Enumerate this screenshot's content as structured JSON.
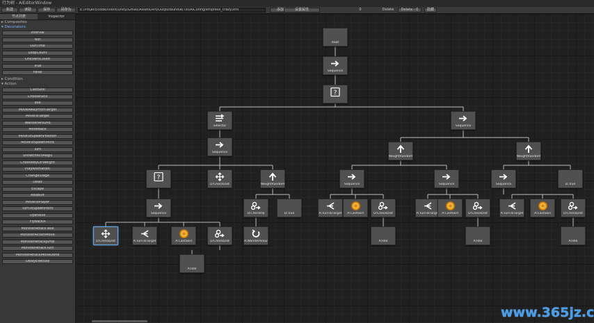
{
  "window": {
    "title": "行为树 - AiEditorWindow",
    "toolbar": {
      "buttons": [
        "新建",
        "读取",
        "保存",
        "另存为"
      ],
      "path": "E:/Project/code/client/unity/Gmall/Assets/Art/OutputBundle/Txt/AiConfig/empress_crazy.xml",
      "action_buttons": [
        "添加节点",
        "设置属性"
      ],
      "zoom": "0",
      "mode": "Delete",
      "mode2": "Delete - 0",
      "extra": "隐藏"
    }
  },
  "sidebar": {
    "tabs": [
      "节点列表",
      "Inspector"
    ],
    "categories": {
      "composites": "Composites",
      "decorators": "Decorators",
      "condition": "Condition",
      "action": "Action"
    },
    "decorator_items": [
      "Interval",
      "Not",
      "OutTime",
      "LoopCount",
      "OnEventCount",
      "True",
      "False"
    ],
    "action_items": [
      "CastSkill",
      "ChooseSkill",
      "Idle",
      "MoveAwayFromTarget",
      "MoveToTarget",
      "WanderAround",
      "MoveBack",
      "MoveToSpawnPosition",
      "MoveToSpawnPoint",
      "Turn",
      "ShowEffectMagic",
      "ChooseByDirWeight",
      "PlayAnimation",
      "ChangeStage",
      "Dead",
      "Escape",
      "AddBuff",
      "MoveToPlayer",
      "TurnToSpawnPoint",
      "OpenBox",
      "FlyBackA",
      "MonsterAttackTask",
      "MonsterActionMove",
      "MonsterAttackJump",
      "MonsterAttackTurn",
      "MonsterAttackMoveDone",
      "DelayExecute"
    ]
  },
  "graph": {
    "nodes": [
      {
        "id": "root",
        "label": "Root",
        "icon": "root"
      },
      {
        "id": "seq1",
        "label": "Sequence",
        "icon": "arrow-right-icon"
      },
      {
        "id": "rnd1",
        "label": "",
        "icon": "random-question-icon"
      },
      {
        "id": "sel1",
        "label": "Selector",
        "icon": "selector-lines-icon"
      },
      {
        "id": "seq2",
        "label": "Sequence",
        "icon": "arrow-right-icon"
      },
      {
        "id": "seq3",
        "label": "Sequence",
        "icon": "arrow-right-icon"
      },
      {
        "id": "wp1",
        "label": "WeightRandom",
        "icon": "arrow-up-icon"
      },
      {
        "id": "wp2",
        "label": "WeightRandom",
        "icon": "arrow-up-icon"
      },
      {
        "id": "rnd2",
        "label": "",
        "icon": "random-question-icon"
      },
      {
        "id": "mv1",
        "label": "D:CheckDist",
        "icon": "move-cross-icon"
      },
      {
        "id": "wp3",
        "label": "WeightRandom",
        "icon": "arrow-up-icon"
      },
      {
        "id": "seq4",
        "label": "Sequence",
        "icon": "arrow-right-icon"
      },
      {
        "id": "seq5",
        "label": "Sequence",
        "icon": "arrow-right-icon"
      },
      {
        "id": "seq6",
        "label": "Sequence",
        "icon": "arrow-right-icon"
      },
      {
        "id": "true1",
        "label": "D:True",
        "icon": "none"
      },
      {
        "id": "seq7",
        "label": "Sequence",
        "icon": "arrow-right-icon"
      },
      {
        "id": "bio1",
        "label": "D:CheckHp",
        "icon": "bio-gear-icon"
      },
      {
        "id": "true2",
        "label": "D:True",
        "icon": "none"
      },
      {
        "id": "turn1",
        "label": "A:TurnToTarget",
        "icon": "turn-left-icon"
      },
      {
        "id": "skill1",
        "label": "A:CastSkill",
        "icon": "skill-orb-icon"
      },
      {
        "id": "bio2",
        "label": "D:CheckDist",
        "icon": "bio-gear-icon"
      },
      {
        "id": "turn2",
        "label": "A:TurnToTarget",
        "icon": "turn-left-icon"
      },
      {
        "id": "skill2",
        "label": "A:CastSkill",
        "icon": "skill-orb-icon"
      },
      {
        "id": "bio3",
        "label": "D:CheckDist",
        "icon": "bio-gear-icon"
      },
      {
        "id": "turn3",
        "label": "A:TurnToTarget",
        "icon": "turn-left-icon"
      },
      {
        "id": "skill3",
        "label": "A:CastSkill",
        "icon": "skill-orb-icon"
      },
      {
        "id": "bio4",
        "label": "D:CheckDist",
        "icon": "bio-gear-icon"
      },
      {
        "id": "mv2",
        "label": "D:CheckDist",
        "icon": "move-cross-icon"
      },
      {
        "id": "turn4",
        "label": "A:TurnToTarget",
        "icon": "turn-left-icon"
      },
      {
        "id": "skill4",
        "label": "A:CastSkill",
        "icon": "skill-orb-icon"
      },
      {
        "id": "bio5",
        "label": "D:CheckDist",
        "icon": "bio-gear-icon"
      },
      {
        "id": "loop1",
        "label": "A:WanderAround",
        "icon": "loop-icon"
      },
      {
        "id": "idle1",
        "label": "A:Idle",
        "icon": "none"
      },
      {
        "id": "idle2",
        "label": "A:Idle",
        "icon": "none"
      },
      {
        "id": "idle3",
        "label": "A:Idle",
        "icon": "none"
      },
      {
        "id": "idle4",
        "label": "A:Idle",
        "icon": "none"
      }
    ]
  },
  "watermark": "www.365jz.com"
}
